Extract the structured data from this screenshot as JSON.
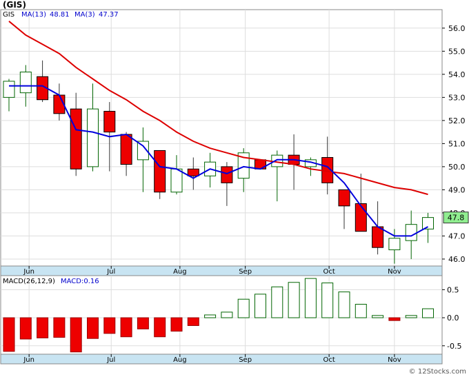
{
  "ticker_title": "(GIS)",
  "watermark": "© 12Stocks.com",
  "price_panel": {
    "legend": {
      "symbol": "GIS",
      "ma13_label": "MA(13)",
      "ma13_value": "48.81",
      "ma3_label": "MA(3)",
      "ma3_value": "47.37"
    },
    "last_price": "47.8"
  },
  "macd_panel": {
    "legend": {
      "label": "MACD(26,12,9)",
      "value_label": "MACD:0.16"
    }
  },
  "colors": {
    "up_fill": "#ffffff",
    "up_stroke": "#006400",
    "down_fill": "#ee0000",
    "ma13": "#dd0000",
    "ma3": "#0000dd",
    "axis_band": "#c8e4f2",
    "price_badge": "#90ee90",
    "grid": "#dddddd"
  },
  "chart_data": [
    {
      "type": "candlestick",
      "title": "(GIS)",
      "x_tick_labels": [
        "Jun",
        "Jul",
        "Aug",
        "Sep",
        "Oct",
        "Nov"
      ],
      "x_tick_index": [
        1.2,
        6.1,
        10.2,
        14.1,
        19.1,
        23.0
      ],
      "ylim": [
        45.7,
        56.8
      ],
      "y_ticks": [
        46.0,
        47.0,
        48.0,
        49.0,
        50.0,
        51.0,
        52.0,
        53.0,
        54.0,
        55.0,
        56.0
      ],
      "y_tick_labels": [
        "46.0",
        "47.0",
        "48.0",
        "49.0",
        "50.0",
        "51.0",
        "52.0",
        "53.0",
        "54.0",
        "55.0",
        "56.0"
      ],
      "grid": true,
      "candles": [
        {
          "open": 53.0,
          "high": 53.8,
          "low": 52.4,
          "close": 53.7
        },
        {
          "open": 53.2,
          "high": 54.4,
          "low": 52.6,
          "close": 54.1
        },
        {
          "open": 53.9,
          "high": 54.6,
          "low": 52.8,
          "close": 52.9
        },
        {
          "open": 53.1,
          "high": 53.6,
          "low": 52.0,
          "close": 52.3
        },
        {
          "open": 52.5,
          "high": 53.2,
          "low": 49.6,
          "close": 49.9
        },
        {
          "open": 50.0,
          "high": 53.6,
          "low": 49.8,
          "close": 52.5
        },
        {
          "open": 52.4,
          "high": 52.8,
          "low": 49.8,
          "close": 51.5
        },
        {
          "open": 51.4,
          "high": 51.5,
          "low": 49.6,
          "close": 50.1
        },
        {
          "open": 50.3,
          "high": 51.7,
          "low": 48.9,
          "close": 51.1
        },
        {
          "open": 50.7,
          "high": 50.7,
          "low": 48.6,
          "close": 48.9
        },
        {
          "open": 48.9,
          "high": 50.5,
          "low": 48.8,
          "close": 49.9
        },
        {
          "open": 49.9,
          "high": 50.4,
          "low": 49.0,
          "close": 49.6
        },
        {
          "open": 49.6,
          "high": 50.6,
          "low": 49.1,
          "close": 50.2
        },
        {
          "open": 50.0,
          "high": 50.2,
          "low": 48.3,
          "close": 49.3
        },
        {
          "open": 49.5,
          "high": 50.8,
          "low": 48.9,
          "close": 50.6
        },
        {
          "open": 50.3,
          "high": 50.3,
          "low": 49.9,
          "close": 49.9
        },
        {
          "open": 50.0,
          "high": 50.7,
          "low": 48.5,
          "close": 50.5
        },
        {
          "open": 50.5,
          "high": 51.4,
          "low": 49.0,
          "close": 50.1
        },
        {
          "open": 50.0,
          "high": 50.4,
          "low": 49.6,
          "close": 50.3
        },
        {
          "open": 50.4,
          "high": 51.3,
          "low": 48.8,
          "close": 49.3
        },
        {
          "open": 49.0,
          "high": 49.0,
          "low": 47.3,
          "close": 48.3
        },
        {
          "open": 48.4,
          "high": 49.7,
          "low": 47.3,
          "close": 47.2
        },
        {
          "open": 47.4,
          "high": 48.5,
          "low": 46.2,
          "close": 46.5
        },
        {
          "open": 46.4,
          "high": 47.3,
          "low": 45.8,
          "close": 46.9
        },
        {
          "open": 46.8,
          "high": 48.1,
          "low": 46.0,
          "close": 47.5
        },
        {
          "open": 47.3,
          "high": 48.0,
          "low": 46.7,
          "close": 47.8
        }
      ],
      "series": [
        {
          "name": "MA(13)",
          "values": [
            56.3,
            55.7,
            55.3,
            54.9,
            54.3,
            53.8,
            53.3,
            52.9,
            52.4,
            52.0,
            51.5,
            51.1,
            50.8,
            50.6,
            50.4,
            50.3,
            50.2,
            50.1,
            49.9,
            49.8,
            49.7,
            49.5,
            49.3,
            49.1,
            49.0,
            48.8
          ]
        },
        {
          "name": "MA(3)",
          "values": [
            53.5,
            53.5,
            53.5,
            53.1,
            51.6,
            51.5,
            51.3,
            51.4,
            50.9,
            50.0,
            49.9,
            49.5,
            49.9,
            49.7,
            50.0,
            49.9,
            50.3,
            50.3,
            50.2,
            50.0,
            49.3,
            48.3,
            47.4,
            47.0,
            47.0,
            47.4
          ]
        }
      ]
    },
    {
      "type": "bar",
      "title": "MACD(26,12,9)",
      "ylim": [
        -0.65,
        0.75
      ],
      "y_ticks": [
        -0.5,
        0.0,
        0.5
      ],
      "y_tick_labels": [
        "-0.5",
        "0.0",
        "0.5"
      ],
      "x_tick_labels": [
        "Jun",
        "Jul",
        "Aug",
        "Sep",
        "Oct",
        "Nov"
      ],
      "x_tick_index": [
        1.2,
        6.1,
        10.2,
        14.1,
        19.1,
        23.0
      ],
      "values": [
        -0.6,
        -0.38,
        -0.36,
        -0.35,
        -0.61,
        -0.37,
        -0.28,
        -0.34,
        -0.2,
        -0.34,
        -0.24,
        -0.14,
        0.05,
        0.1,
        0.33,
        0.42,
        0.55,
        0.63,
        0.7,
        0.62,
        0.46,
        0.24,
        0.04,
        -0.05,
        0.04,
        0.16
      ]
    }
  ]
}
